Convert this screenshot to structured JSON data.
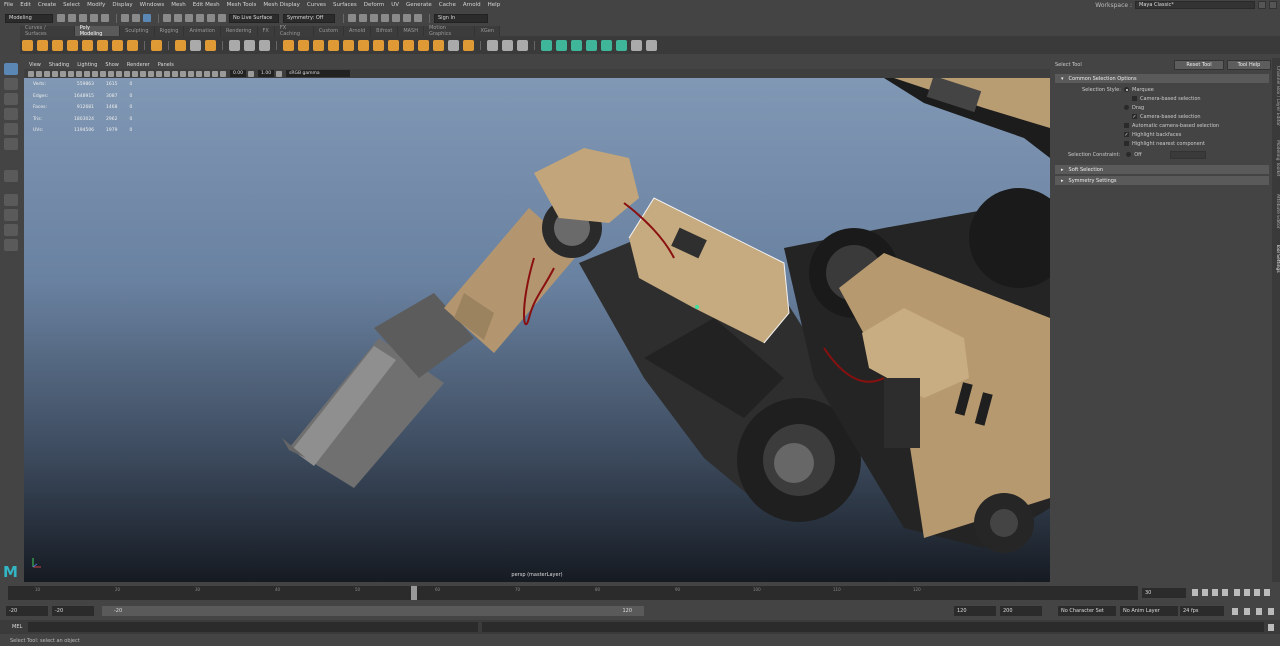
{
  "menubar": {
    "items": [
      "File",
      "Edit",
      "Create",
      "Select",
      "Modify",
      "Display",
      "Windows",
      "Mesh",
      "Edit Mesh",
      "Mesh Tools",
      "Mesh Display",
      "Curves",
      "Surfaces",
      "Deform",
      "UV",
      "Generate",
      "Cache",
      "Arnold",
      "Help"
    ]
  },
  "workspace": {
    "label": "Workspace :",
    "value": "Maya Classic*"
  },
  "status": {
    "mode": "Modeling",
    "live_surface": "No Live Surface",
    "symmetry": "Symmetry: Off",
    "sign_in": "Sign In"
  },
  "shelf": {
    "tabs": [
      "Curves / Surfaces",
      "Poly Modeling",
      "Sculpting",
      "Rigging",
      "Animation",
      "Rendering",
      "FX",
      "FX Caching",
      "Custom",
      "Arnold",
      "Bifrost",
      "MASH",
      "Motion Graphics",
      "XGen"
    ],
    "active": "Poly Modeling"
  },
  "viewport": {
    "menu": [
      "View",
      "Shading",
      "Lighting",
      "Show",
      "Renderer",
      "Panels"
    ],
    "exposure": "0.00",
    "gamma": "1.00",
    "colorspace": "sRGB gamma",
    "hud": [
      {
        "label": "Verts:",
        "total": "559863",
        "sel": "1615",
        "extra": "0"
      },
      {
        "label": "Edges:",
        "total": "1648915",
        "sel": "3087",
        "extra": "0"
      },
      {
        "label": "Faces:",
        "total": "912681",
        "sel": "1468",
        "extra": "0"
      },
      {
        "label": "Tris:",
        "total": "1803024",
        "sel": "2962",
        "extra": "0"
      },
      {
        "label": "UVs:",
        "total": "1194506",
        "sel": "1979",
        "extra": "0"
      }
    ],
    "camera_label": "persp (masterLayer)"
  },
  "tool_settings": {
    "title": "Select Tool",
    "reset": "Reset Tool",
    "help": "Tool Help",
    "section_common": "Common Selection Options",
    "selection_style_label": "Selection Style:",
    "marquee": "Marquee",
    "camera_based_1": "Camera-based selection",
    "drag": "Drag",
    "camera_based_2": "Camera-based selection",
    "auto_camera": "Automatic camera-based selection",
    "highlight_backfaces": "Highlight backfaces",
    "highlight_nearest": "Highlight nearest component",
    "constraint_label": "Selection Constraint:",
    "constraint_value": "Off",
    "soft_selection": "Soft Selection",
    "symmetry_settings": "Symmetry Settings"
  },
  "side_tabs": [
    "Channel Box / Layer Editor",
    "Modeling Toolkit",
    "Attribute Editor",
    "Tool Settings"
  ],
  "timeline": {
    "ticks": [
      "10",
      "20",
      "30",
      "40",
      "50",
      "60",
      "70",
      "80",
      "90",
      "100",
      "110",
      "120"
    ],
    "current_frame": "30",
    "range_start": "-20",
    "anim_start": "-20",
    "slider_start": "-20",
    "slider_end": "120",
    "anim_end": "120",
    "range_end": "200",
    "character_set": "No Character Set",
    "anim_layer": "No Anim Layer",
    "fps": "24 fps"
  },
  "command": {
    "lang": "MEL"
  },
  "help_line": "Select Tool: select an object"
}
